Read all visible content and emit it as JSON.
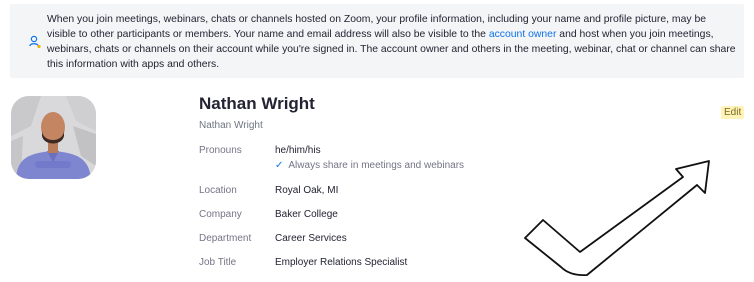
{
  "notice": {
    "text_before": "When you join meetings, webinars, chats or channels hosted on Zoom, your profile information, including your name and profile picture, may be visible to other participants or members. Your name and email address will also be visible to the ",
    "link": "account owner",
    "text_after": " and host when you join meetings, webinars, chats or channels on their account while you're signed in. The account owner and others in the meeting, webinar, chat or channel can share this information with apps and others.",
    "icon": "user-privacy-icon"
  },
  "profile": {
    "name": "Nathan Wright",
    "display_name": "Nathan Wright",
    "edit_label": "Edit",
    "avatar_icon": "profile-photo"
  },
  "fields": {
    "pronouns": {
      "label": "Pronouns",
      "value": "he/him/his",
      "share_note": "Always share in meetings and webinars"
    },
    "location": {
      "label": "Location",
      "value": "Royal Oak, MI"
    },
    "company": {
      "label": "Company",
      "value": "Baker College"
    },
    "department": {
      "label": "Department",
      "value": "Career Services"
    },
    "job_title": {
      "label": "Job Title",
      "value": "Employer Relations Specialist"
    }
  },
  "colors": {
    "link": "#0e72ed",
    "edit_bg": "#fff3b8",
    "notice_bg": "#f4f5f7"
  }
}
